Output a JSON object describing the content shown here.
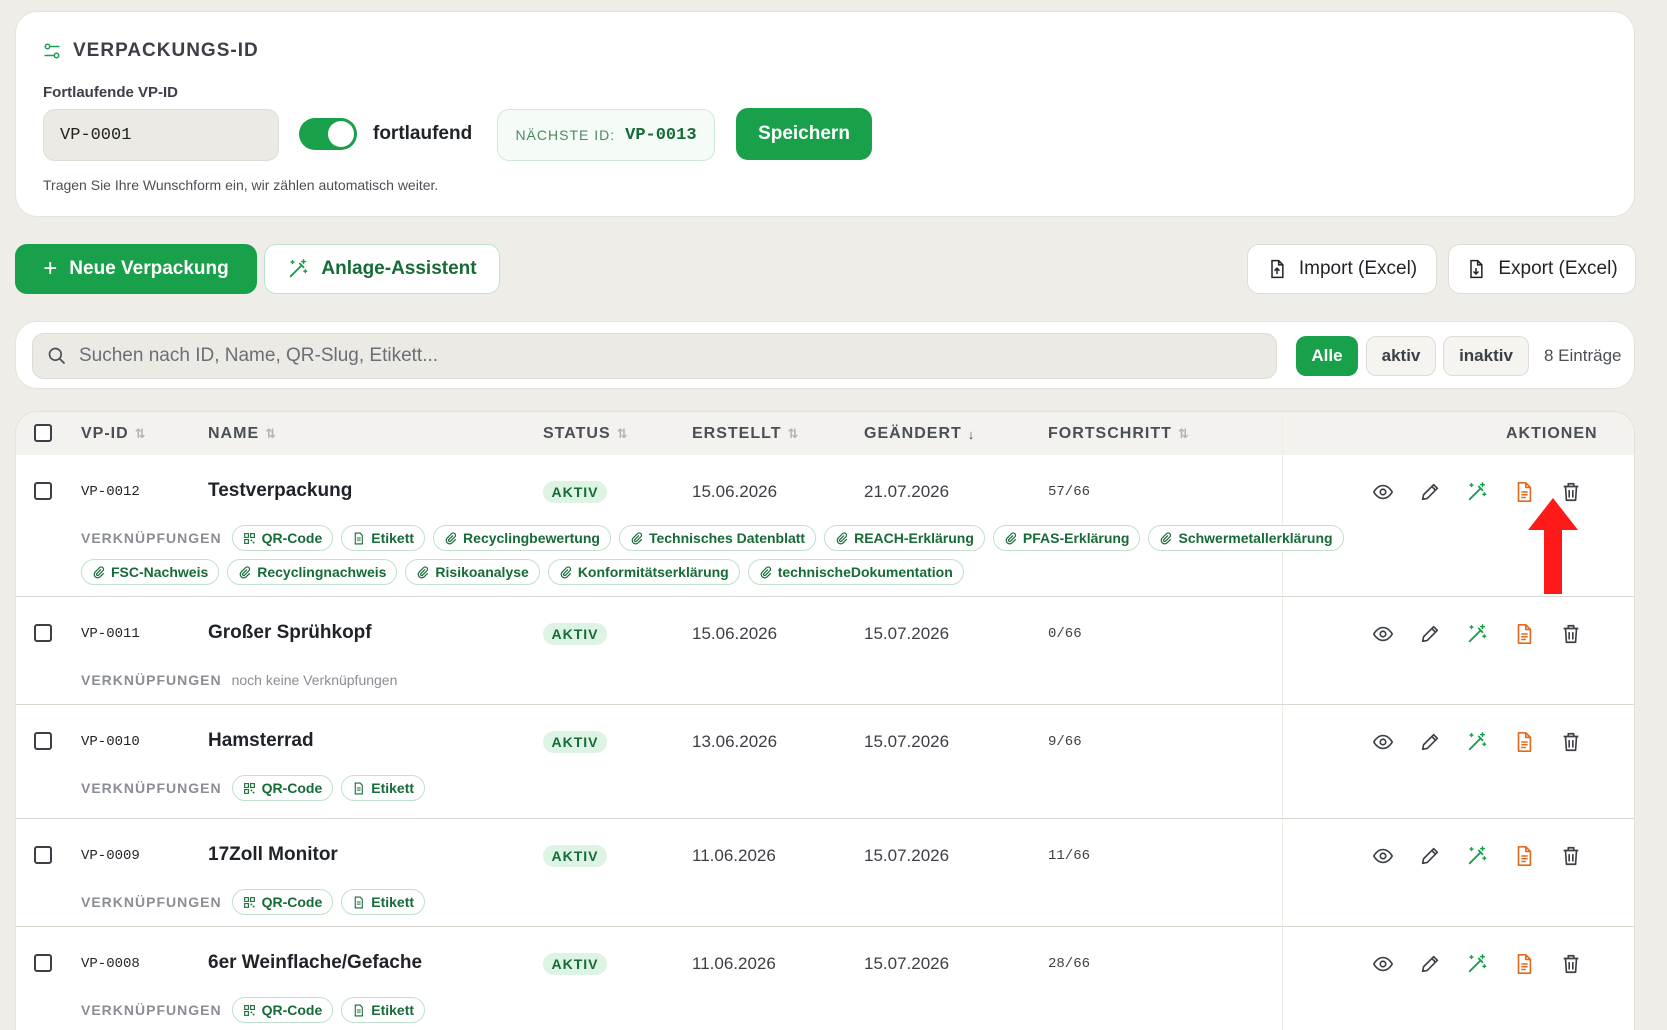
{
  "vp_card": {
    "title": "VERPACKUNGS-ID",
    "field_label": "Fortlaufende VP-ID",
    "input_value": "VP-0001",
    "toggle_label": "fortlaufend",
    "next_id_label": "NÄCHSTE ID:",
    "next_id_value": "VP-0013",
    "save_label": "Speichern",
    "hint": "Tragen Sie Ihre Wunschform ein, wir zählen automatisch weiter."
  },
  "toolbar": {
    "new_label": "Neue Verpackung",
    "assist_label": "Anlage-Assistent",
    "import_label": "Import (Excel)",
    "export_label": "Export (Excel)"
  },
  "search": {
    "placeholder": "Suchen nach ID, Name, QR-Slug, Etikett...",
    "filters": [
      "Alle",
      "aktiv",
      "inaktiv"
    ],
    "count": "8 Einträge"
  },
  "table": {
    "headers": {
      "vpid": "VP-ID",
      "name": "NAME",
      "status": "STATUS",
      "created": "ERSTELLT",
      "changed": "GEÄNDERT",
      "progress": "FORTSCHRITT",
      "actions": "AKTIONEN"
    },
    "links_label": "VERKNÜPFUNGEN",
    "rows": [
      {
        "vpid": "VP-0012",
        "name": "Testverpackung",
        "status": "AKTIV",
        "created": "15.06.2026",
        "changed": "21.07.2026",
        "progress": "57/66",
        "links": [
          "QR-Code",
          "Etikett",
          "Recyclingbewertung",
          "Technisches Datenblatt",
          "REACH-Erklärung",
          "PFAS-Erklärung",
          "Schwermetallerklärung",
          "FSC-Nachweis",
          "Recyclingnachweis",
          "Risikoanalyse",
          "Konformitätserklärung",
          "technischeDokumentation"
        ]
      },
      {
        "vpid": "VP-0011",
        "name": "Großer Sprühkopf",
        "status": "AKTIV",
        "created": "15.06.2026",
        "changed": "15.07.2026",
        "progress": "0/66",
        "no_links": "noch keine Verknüpfungen"
      },
      {
        "vpid": "VP-0010",
        "name": "Hamsterrad",
        "status": "AKTIV",
        "created": "13.06.2026",
        "changed": "15.07.2026",
        "progress": "9/66",
        "links": [
          "QR-Code",
          "Etikett"
        ]
      },
      {
        "vpid": "VP-0009",
        "name": "17Zoll Monitor",
        "status": "AKTIV",
        "created": "11.06.2026",
        "changed": "15.07.2026",
        "progress": "11/66",
        "links": [
          "QR-Code",
          "Etikett"
        ]
      },
      {
        "vpid": "VP-0008",
        "name": "6er Weinflache/Gefache",
        "status": "AKTIV",
        "created": "11.06.2026",
        "changed": "15.07.2026",
        "progress": "28/66",
        "links": [
          "QR-Code",
          "Etikett"
        ]
      }
    ]
  },
  "colors": {
    "accent": "#18a04a",
    "document_icon": "#e06a1f",
    "annotation_arrow": "#ff1a1a"
  }
}
